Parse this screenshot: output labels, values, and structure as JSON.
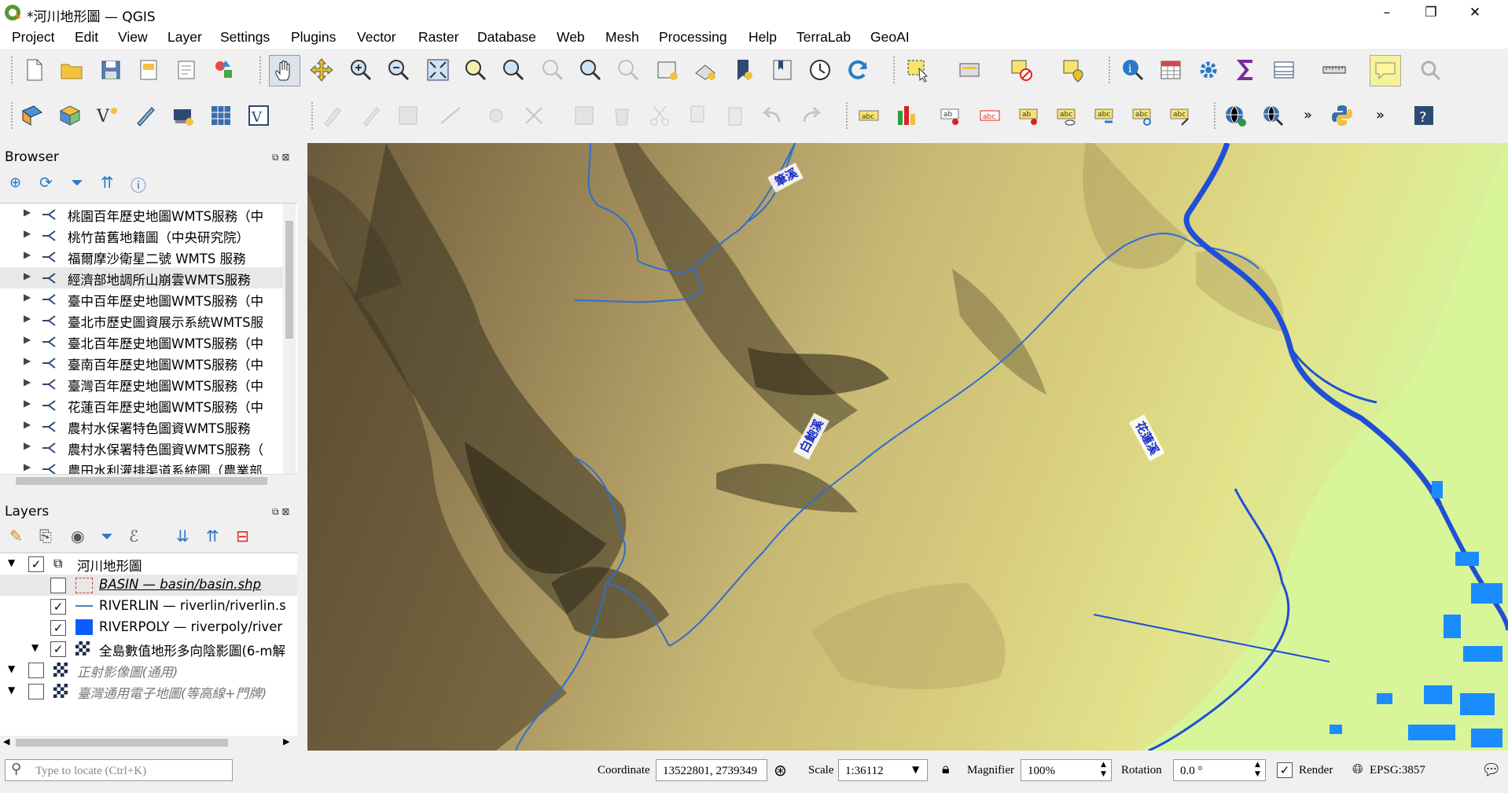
{
  "window": {
    "title": "*河川地形圖 — QGIS",
    "minimize": "–",
    "maximize": "❐",
    "close": "✕"
  },
  "menu": [
    "Project",
    "Edit",
    "View",
    "Layer",
    "Settings",
    "Plugins",
    "Vector",
    "Raster",
    "Database",
    "Web",
    "Mesh",
    "Processing",
    "Help",
    "TerraLab",
    "GeoAI"
  ],
  "browser": {
    "title": "Browser",
    "items": [
      "桃園百年歷史地圖WMTS服務（中",
      "桃竹苗舊地籍圖（中央研究院）",
      "福爾摩沙衛星二號 WMTS 服務",
      "經濟部地調所山崩雲WMTS服務",
      "臺中百年歷史地圖WMTS服務（中",
      "臺北市歷史圖資展示系統WMTS服",
      "臺北百年歷史地圖WMTS服務（中",
      "臺南百年歷史地圖WMTS服務（中",
      "臺灣百年歷史地圖WMTS服務（中",
      "花蓮百年歷史地圖WMTS服務（中",
      "農村水保署特色圖資WMTS服務",
      "農村水保署特色圖資WMTS服務（",
      "農田水利灌排渠道系統圖（農業部"
    ]
  },
  "layers": {
    "title": "Layers",
    "group": "河川地形圖",
    "items": [
      {
        "label": "BASIN — basin/basin.shp",
        "checked": false
      },
      {
        "label": "RIVERLIN — riverlin/riverlin.s",
        "checked": true
      },
      {
        "label": "RIVERPOLY — riverpoly/river",
        "checked": true
      },
      {
        "label": "全島數值地形多向陰影圖(6-m解",
        "checked": true
      }
    ],
    "basemaps": [
      "正射影像圖(通用)",
      "臺灣通用電子地圖(等高線+門牌)"
    ]
  },
  "map": {
    "labels": [
      "筆溪",
      "白鮑溪",
      "花蓮溪"
    ],
    "colors": {
      "river": "#1f4fd6",
      "lowland": "#d8f59a",
      "hillshade_dark": "#3b3422",
      "hillshade_light": "#d9c98a"
    }
  },
  "status": {
    "locate_placeholder": "Type to locate (Ctrl+K)",
    "coordinate_label": "Coordinate",
    "coordinate_value": "13522801, 2739349",
    "scale_label": "Scale",
    "scale_value": "1:36112",
    "magnifier_label": "Magnifier",
    "magnifier_value": "100%",
    "rotation_label": "Rotation",
    "rotation_value": "0.0 °",
    "render_label": "Render",
    "crs": "EPSG:3857"
  }
}
